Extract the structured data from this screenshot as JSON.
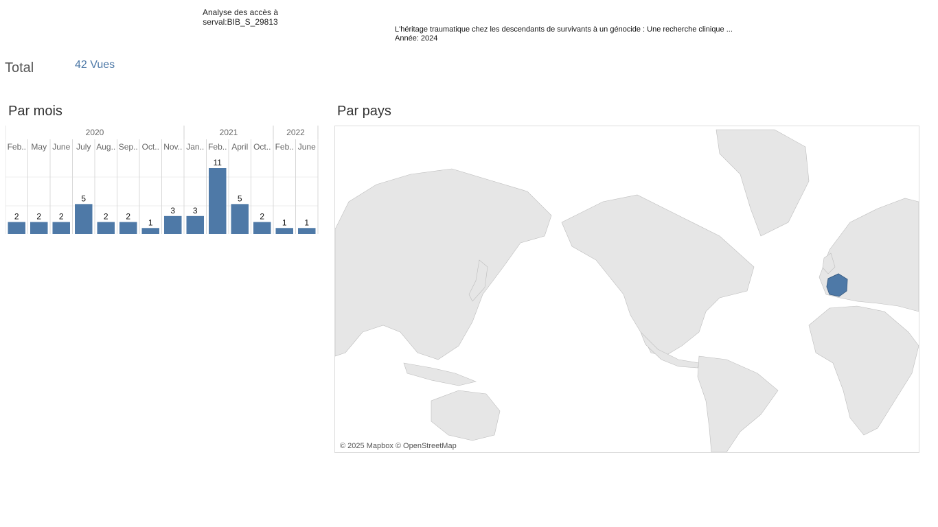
{
  "header": {
    "title_line1": "Analyse des accès à",
    "title_line2": "serval:BIB_S_29813"
  },
  "document": {
    "title": "L'héritage traumatique chez les descendants de survivants à un génocide : Une recherche clinique ...",
    "year_label": "Année: 2024"
  },
  "total": {
    "label": "Total",
    "value": "42 Vues"
  },
  "sections": {
    "monthly": "Par mois",
    "country": "Par pays"
  },
  "chart_data": {
    "type": "bar",
    "title": "Par mois",
    "years": [
      {
        "label": "2020",
        "span": 8
      },
      {
        "label": "2021",
        "span": 4
      },
      {
        "label": "2022",
        "span": 2
      }
    ],
    "categories": [
      "Feb..",
      "May",
      "June",
      "July",
      "Aug..",
      "Sep..",
      "Oct..",
      "Nov..",
      "Jan..",
      "Feb..",
      "April",
      "Oct..",
      "Feb..",
      "June"
    ],
    "values": [
      2,
      2,
      2,
      5,
      2,
      2,
      1,
      3,
      3,
      11,
      5,
      2,
      1,
      1
    ],
    "ylim": [
      0,
      11
    ],
    "grid": true,
    "bar_color": "#4e79a7"
  },
  "map": {
    "highlighted_country": "France",
    "highlight_color": "#4e79a7",
    "land_color": "#e6e6e6",
    "attribution": "© 2025 Mapbox © OpenStreetMap"
  }
}
